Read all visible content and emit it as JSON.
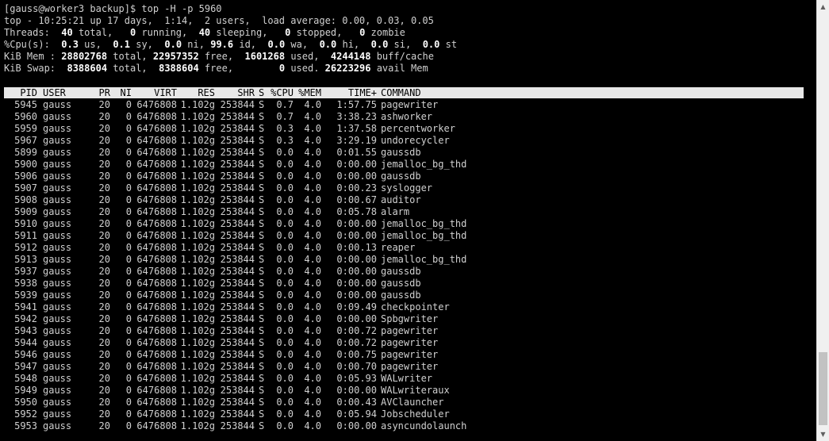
{
  "terminal": {
    "prompt_line": "[gauss@worker3 backup]$ top -H -p 5960",
    "summary": {
      "top_line": "top - 10:25:21 up 17 days,  1:14,  2 users,  load average: 0.00, 0.03, 0.05",
      "threads": {
        "label": "Threads:",
        "total": "40",
        "total_label": "total,",
        "running": "0",
        "running_label": "running,",
        "sleeping": "40",
        "sleeping_label": "sleeping,",
        "stopped": "0",
        "stopped_label": "stopped,",
        "zombie": "0",
        "zombie_label": "zombie"
      },
      "cpu": {
        "label": "%Cpu(s):",
        "us": "0.3",
        "us_label": "us,",
        "sy": "0.1",
        "sy_label": "sy,",
        "ni": "0.0",
        "ni_label": "ni,",
        "id": "99.6",
        "id_label": "id,",
        "wa": "0.0",
        "wa_label": "wa,",
        "hi": "0.0",
        "hi_label": "hi,",
        "si": "0.0",
        "si_label": "si,",
        "st": "0.0",
        "st_label": "st"
      },
      "mem": {
        "label": "KiB Mem :",
        "total": "28802768",
        "total_label": "total,",
        "free": "22957352",
        "free_label": "free,",
        "used": "1601268",
        "used_label": "used,",
        "buff_cache": "4244148",
        "buff_cache_label": "buff/cache"
      },
      "swap": {
        "label": "KiB Swap:",
        "total": "8388604",
        "total_label": "total,",
        "free": "8388604",
        "free_label": "free,",
        "used": "0",
        "used_label": "used.",
        "avail": "26223296",
        "avail_label": "avail Mem"
      }
    },
    "columns": [
      "PID",
      "USER",
      "PR",
      "NI",
      "VIRT",
      "RES",
      "SHR",
      "S",
      "%CPU",
      "%MEM",
      "TIME+",
      "COMMAND"
    ],
    "processes": [
      {
        "pid": "5945",
        "user": "gauss",
        "pr": "20",
        "ni": "0",
        "virt": "6476808",
        "res": "1.102g",
        "shr": "253844",
        "s": "S",
        "cpu": "0.7",
        "mem": "4.0",
        "time": "1:57.75",
        "command": "pagewriter"
      },
      {
        "pid": "5960",
        "user": "gauss",
        "pr": "20",
        "ni": "0",
        "virt": "6476808",
        "res": "1.102g",
        "shr": "253844",
        "s": "S",
        "cpu": "0.7",
        "mem": "4.0",
        "time": "3:38.23",
        "command": "ashworker"
      },
      {
        "pid": "5959",
        "user": "gauss",
        "pr": "20",
        "ni": "0",
        "virt": "6476808",
        "res": "1.102g",
        "shr": "253844",
        "s": "S",
        "cpu": "0.3",
        "mem": "4.0",
        "time": "1:37.58",
        "command": "percentworker"
      },
      {
        "pid": "5967",
        "user": "gauss",
        "pr": "20",
        "ni": "0",
        "virt": "6476808",
        "res": "1.102g",
        "shr": "253844",
        "s": "S",
        "cpu": "0.3",
        "mem": "4.0",
        "time": "3:29.19",
        "command": "undorecycler"
      },
      {
        "pid": "5899",
        "user": "gauss",
        "pr": "20",
        "ni": "0",
        "virt": "6476808",
        "res": "1.102g",
        "shr": "253844",
        "s": "S",
        "cpu": "0.0",
        "mem": "4.0",
        "time": "0:01.55",
        "command": "gaussdb"
      },
      {
        "pid": "5900",
        "user": "gauss",
        "pr": "20",
        "ni": "0",
        "virt": "6476808",
        "res": "1.102g",
        "shr": "253844",
        "s": "S",
        "cpu": "0.0",
        "mem": "4.0",
        "time": "0:00.00",
        "command": "jemalloc_bg_thd"
      },
      {
        "pid": "5906",
        "user": "gauss",
        "pr": "20",
        "ni": "0",
        "virt": "6476808",
        "res": "1.102g",
        "shr": "253844",
        "s": "S",
        "cpu": "0.0",
        "mem": "4.0",
        "time": "0:00.00",
        "command": "gaussdb"
      },
      {
        "pid": "5907",
        "user": "gauss",
        "pr": "20",
        "ni": "0",
        "virt": "6476808",
        "res": "1.102g",
        "shr": "253844",
        "s": "S",
        "cpu": "0.0",
        "mem": "4.0",
        "time": "0:00.23",
        "command": "syslogger"
      },
      {
        "pid": "5908",
        "user": "gauss",
        "pr": "20",
        "ni": "0",
        "virt": "6476808",
        "res": "1.102g",
        "shr": "253844",
        "s": "S",
        "cpu": "0.0",
        "mem": "4.0",
        "time": "0:00.67",
        "command": "auditor"
      },
      {
        "pid": "5909",
        "user": "gauss",
        "pr": "20",
        "ni": "0",
        "virt": "6476808",
        "res": "1.102g",
        "shr": "253844",
        "s": "S",
        "cpu": "0.0",
        "mem": "4.0",
        "time": "0:05.78",
        "command": "alarm"
      },
      {
        "pid": "5910",
        "user": "gauss",
        "pr": "20",
        "ni": "0",
        "virt": "6476808",
        "res": "1.102g",
        "shr": "253844",
        "s": "S",
        "cpu": "0.0",
        "mem": "4.0",
        "time": "0:00.00",
        "command": "jemalloc_bg_thd"
      },
      {
        "pid": "5911",
        "user": "gauss",
        "pr": "20",
        "ni": "0",
        "virt": "6476808",
        "res": "1.102g",
        "shr": "253844",
        "s": "S",
        "cpu": "0.0",
        "mem": "4.0",
        "time": "0:00.00",
        "command": "jemalloc_bg_thd"
      },
      {
        "pid": "5912",
        "user": "gauss",
        "pr": "20",
        "ni": "0",
        "virt": "6476808",
        "res": "1.102g",
        "shr": "253844",
        "s": "S",
        "cpu": "0.0",
        "mem": "4.0",
        "time": "0:00.13",
        "command": "reaper"
      },
      {
        "pid": "5913",
        "user": "gauss",
        "pr": "20",
        "ni": "0",
        "virt": "6476808",
        "res": "1.102g",
        "shr": "253844",
        "s": "S",
        "cpu": "0.0",
        "mem": "4.0",
        "time": "0:00.00",
        "command": "jemalloc_bg_thd"
      },
      {
        "pid": "5937",
        "user": "gauss",
        "pr": "20",
        "ni": "0",
        "virt": "6476808",
        "res": "1.102g",
        "shr": "253844",
        "s": "S",
        "cpu": "0.0",
        "mem": "4.0",
        "time": "0:00.00",
        "command": "gaussdb"
      },
      {
        "pid": "5938",
        "user": "gauss",
        "pr": "20",
        "ni": "0",
        "virt": "6476808",
        "res": "1.102g",
        "shr": "253844",
        "s": "S",
        "cpu": "0.0",
        "mem": "4.0",
        "time": "0:00.00",
        "command": "gaussdb"
      },
      {
        "pid": "5939",
        "user": "gauss",
        "pr": "20",
        "ni": "0",
        "virt": "6476808",
        "res": "1.102g",
        "shr": "253844",
        "s": "S",
        "cpu": "0.0",
        "mem": "4.0",
        "time": "0:00.00",
        "command": "gaussdb"
      },
      {
        "pid": "5941",
        "user": "gauss",
        "pr": "20",
        "ni": "0",
        "virt": "6476808",
        "res": "1.102g",
        "shr": "253844",
        "s": "S",
        "cpu": "0.0",
        "mem": "4.0",
        "time": "0:09.49",
        "command": "checkpointer"
      },
      {
        "pid": "5942",
        "user": "gauss",
        "pr": "20",
        "ni": "0",
        "virt": "6476808",
        "res": "1.102g",
        "shr": "253844",
        "s": "S",
        "cpu": "0.0",
        "mem": "4.0",
        "time": "0:00.00",
        "command": "Spbgwriter"
      },
      {
        "pid": "5943",
        "user": "gauss",
        "pr": "20",
        "ni": "0",
        "virt": "6476808",
        "res": "1.102g",
        "shr": "253844",
        "s": "S",
        "cpu": "0.0",
        "mem": "4.0",
        "time": "0:00.72",
        "command": "pagewriter"
      },
      {
        "pid": "5944",
        "user": "gauss",
        "pr": "20",
        "ni": "0",
        "virt": "6476808",
        "res": "1.102g",
        "shr": "253844",
        "s": "S",
        "cpu": "0.0",
        "mem": "4.0",
        "time": "0:00.72",
        "command": "pagewriter"
      },
      {
        "pid": "5946",
        "user": "gauss",
        "pr": "20",
        "ni": "0",
        "virt": "6476808",
        "res": "1.102g",
        "shr": "253844",
        "s": "S",
        "cpu": "0.0",
        "mem": "4.0",
        "time": "0:00.75",
        "command": "pagewriter"
      },
      {
        "pid": "5947",
        "user": "gauss",
        "pr": "20",
        "ni": "0",
        "virt": "6476808",
        "res": "1.102g",
        "shr": "253844",
        "s": "S",
        "cpu": "0.0",
        "mem": "4.0",
        "time": "0:00.70",
        "command": "pagewriter"
      },
      {
        "pid": "5948",
        "user": "gauss",
        "pr": "20",
        "ni": "0",
        "virt": "6476808",
        "res": "1.102g",
        "shr": "253844",
        "s": "S",
        "cpu": "0.0",
        "mem": "4.0",
        "time": "0:05.93",
        "command": "WALwriter"
      },
      {
        "pid": "5949",
        "user": "gauss",
        "pr": "20",
        "ni": "0",
        "virt": "6476808",
        "res": "1.102g",
        "shr": "253844",
        "s": "S",
        "cpu": "0.0",
        "mem": "4.0",
        "time": "0:00.00",
        "command": "WALwriteraux"
      },
      {
        "pid": "5950",
        "user": "gauss",
        "pr": "20",
        "ni": "0",
        "virt": "6476808",
        "res": "1.102g",
        "shr": "253844",
        "s": "S",
        "cpu": "0.0",
        "mem": "4.0",
        "time": "0:00.43",
        "command": "AVClauncher"
      },
      {
        "pid": "5952",
        "user": "gauss",
        "pr": "20",
        "ni": "0",
        "virt": "6476808",
        "res": "1.102g",
        "shr": "253844",
        "s": "S",
        "cpu": "0.0",
        "mem": "4.0",
        "time": "0:05.94",
        "command": "Jobscheduler"
      },
      {
        "pid": "5953",
        "user": "gauss",
        "pr": "20",
        "ni": "0",
        "virt": "6476808",
        "res": "1.102g",
        "shr": "253844",
        "s": "S",
        "cpu": "0.0",
        "mem": "4.0",
        "time": "0:00.00",
        "command": "asyncundolaunch"
      }
    ]
  },
  "scrollbar": {
    "up_icon": "triangle-up-icon",
    "down_icon": "triangle-down-icon"
  },
  "colors": {
    "background": "#000000",
    "text": "#d0d0d0",
    "bold": "#ffffff",
    "header_bar": "#e8e8e8",
    "header_text": "#000000"
  }
}
